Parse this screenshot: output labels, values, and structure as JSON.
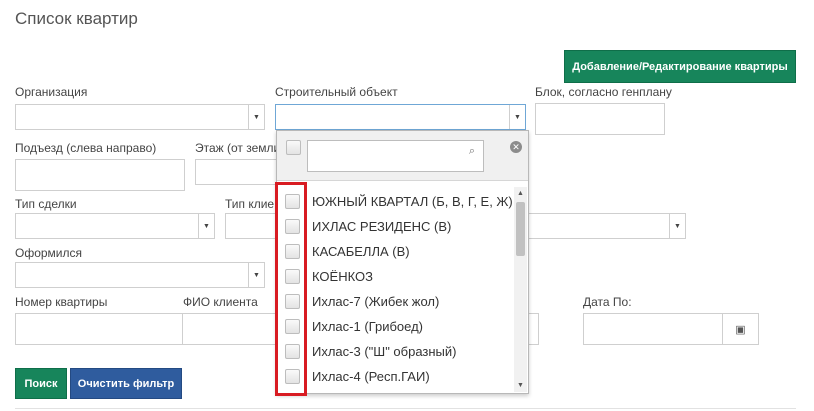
{
  "page": {
    "title": "Список квартир",
    "add_button": "Добавление/Редактирование квартиры"
  },
  "filters": {
    "organization": {
      "label": "Организация",
      "value": ""
    },
    "building_object": {
      "label": "Строительный объект",
      "value": ""
    },
    "block": {
      "label": "Блок, согласно генплану",
      "value": ""
    },
    "entrance": {
      "label": "Подъезд (слева направо)",
      "value": ""
    },
    "floor": {
      "label": "Этаж (от земли",
      "value": ""
    },
    "deal_type": {
      "label": "Тип сделки",
      "value": ""
    },
    "client_type": {
      "label": "Тип клие",
      "value": ""
    },
    "registered": {
      "label": "Оформился",
      "value": ""
    },
    "apartment_number": {
      "label": "Номер квартиры",
      "value": ""
    },
    "client_name": {
      "label": "ФИО клиента",
      "value": ""
    },
    "date_to": {
      "label": "Дата По:",
      "value": ""
    }
  },
  "buttons": {
    "search": "Поиск",
    "clear": "Очистить фильтр"
  },
  "dropdown": {
    "search_value": "",
    "options": [
      "ЮЖНЫЙ КВАРТАЛ (Б, В, Г, Е, Ж)",
      "ИХЛАС РЕЗИДЕНС (В)",
      "КАСАБЕЛЛА (В)",
      "КОЁНКОЗ",
      "Ихлас-7 (Жибек жол)",
      "Ихлас-1 (Грибоед)",
      "Ихлас-3 (\"Ш\" образный)",
      "Ихлас-4 (Респ.ГАИ)"
    ]
  },
  "colors": {
    "primary_green": "#17855b",
    "clear_blue": "#2f5c9e",
    "highlight_red": "#d81b22"
  }
}
